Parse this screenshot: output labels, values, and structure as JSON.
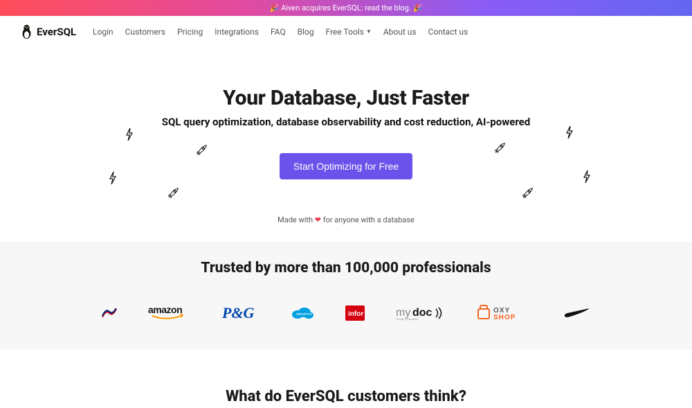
{
  "announcement": {
    "text": "🎉 Aiven acquires EverSQL: read the blog. 🎉"
  },
  "brand": {
    "name": "EverSQL"
  },
  "nav": {
    "login": "Login",
    "customers": "Customers",
    "pricing": "Pricing",
    "integrations": "Integrations",
    "faq": "FAQ",
    "blog": "Blog",
    "freeTools": "Free Tools",
    "about": "About us",
    "contact": "Contact us"
  },
  "hero": {
    "title": "Your Database, Just Faster",
    "subtitle": "SQL query optimization, database observability and cost reduction, AI-powered",
    "cta": "Start Optimizing for Free",
    "madePrefix": "Made with ",
    "madeSuffix": " for anyone with a database"
  },
  "trusted": {
    "heading": "Trusted by more than 100,000 professionals"
  },
  "testimonials": {
    "heading": "What do EverSQL customers think?"
  }
}
